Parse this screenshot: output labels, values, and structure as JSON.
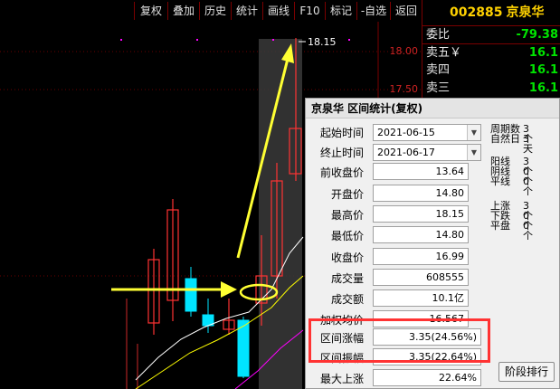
{
  "toolbar": {
    "buttons": [
      "复权",
      "叠加",
      "历史",
      "统计",
      "画线",
      "F10",
      "标记",
      "-自选",
      "返回"
    ]
  },
  "chart": {
    "price_labels": [
      "18.00",
      "17.50"
    ],
    "peak_label": "18.15",
    "colors": {
      "up": "#ff3232",
      "down": "#00e4ff",
      "ma1": "#ffffff",
      "ma2": "#ffff00",
      "ma3": "#ff00ff",
      "arrow": "#ffff33"
    }
  },
  "quote": {
    "code": "002885",
    "name": "京泉华",
    "rows": [
      {
        "label": "委比",
        "value": "-79.38",
        "color": "#00e400"
      },
      {
        "label": "卖五￥",
        "value": "16.1",
        "color": "#00e400"
      },
      {
        "label": "卖四",
        "value": "16.1",
        "color": "#00e400"
      },
      {
        "label": "卖三",
        "value": "16.1",
        "color": "#00e400"
      }
    ]
  },
  "dialog": {
    "title": "京泉华 区间统计(复权)",
    "start_label": "起始时间",
    "start_value": "2021-06-15",
    "end_label": "终止时间",
    "end_value": "2021-06-17",
    "fields": [
      {
        "label": "前收盘价",
        "value": "13.64"
      },
      {
        "label": "开盘价",
        "value": "14.80"
      },
      {
        "label": "最高价",
        "value": "18.15"
      },
      {
        "label": "最低价",
        "value": "14.80"
      },
      {
        "label": "收盘价",
        "value": "16.99"
      },
      {
        "label": "成交量",
        "value": "608555"
      },
      {
        "label": "成交额",
        "value": "10.1亿"
      },
      {
        "label": "加权均价",
        "value": "16.567"
      },
      {
        "label": "区间涨幅",
        "value": "3.35(24.56%)"
      },
      {
        "label": "区间振幅",
        "value": "3.35(22.64%)"
      },
      {
        "label": "最大上涨",
        "value": "22.64%"
      }
    ],
    "period_stats": [
      {
        "label": "周期数",
        "value": "3个"
      },
      {
        "label": "自然日",
        "value": "3天"
      }
    ],
    "candle_stats": [
      {
        "label": "阳线",
        "value": "3个"
      },
      {
        "label": "阴线",
        "value": "0个"
      },
      {
        "label": "平线",
        "value": "0个"
      }
    ],
    "move_stats": [
      {
        "label": "上涨",
        "value": "3个"
      },
      {
        "label": "下跌",
        "value": "0个"
      },
      {
        "label": "平盘",
        "value": "0个"
      }
    ],
    "rank_button": "阶段排行"
  }
}
